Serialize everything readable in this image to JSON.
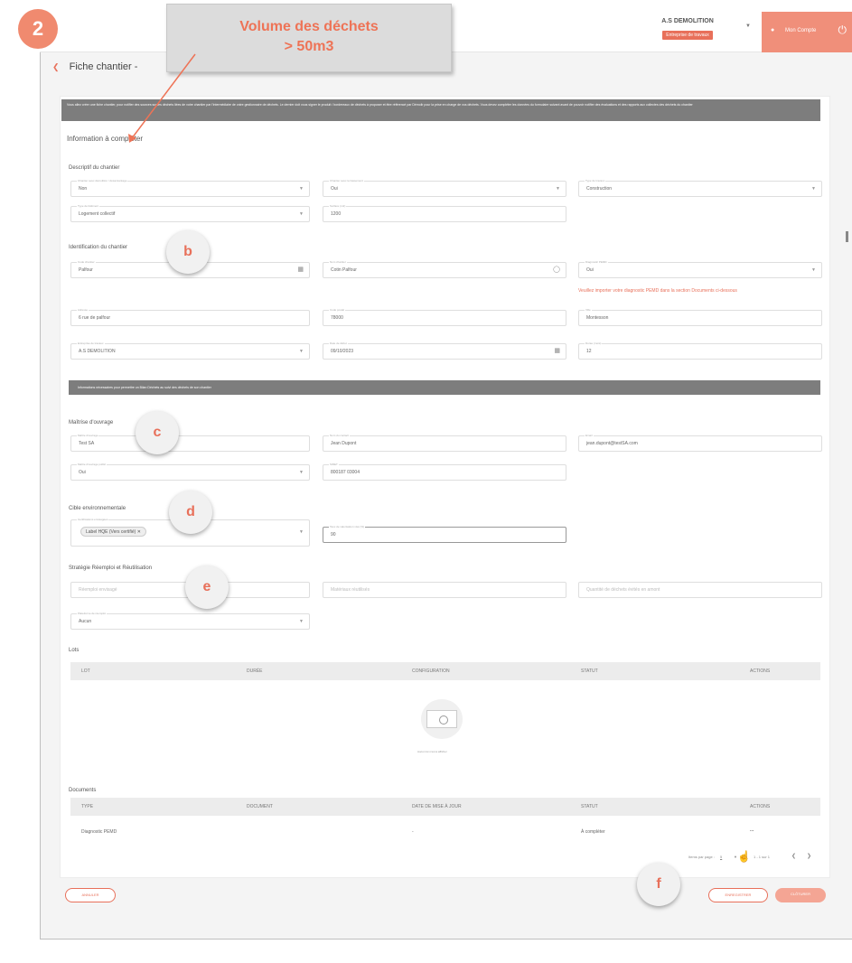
{
  "header": {
    "company_name": "A.S DEMOLITION",
    "company_badge": "Entreprise de travaux",
    "user_name": "Mon Compte"
  },
  "page": {
    "title": "Fiche chantier -",
    "info_banner": "Vous allez créer une fiche chantier, pour notifier des sources sur les déchets liées de votre chantier par l'intermédiaire de votre gestionnaire de déchets. Le dernier doit vous signer le produit / bordereaux de déchets à proposer et être référencé par Démolir pour la prise en charge de vos déchets. Vous devez compléter les données du formulaire suivant avant de pouvoir notifier des évaluations et des rapports aux collectes des déchets du chantier",
    "section_info": "Information à compléter"
  },
  "descriptif": {
    "title": "Descriptif du chantier",
    "fields": [
      {
        "label": "Chantier avec démolition / désamiantage",
        "value": "Non"
      },
      {
        "label": "Chantier avec terrassement",
        "value": "Oui"
      },
      {
        "label": "Type de travaux",
        "value": "Construction"
      },
      {
        "label": "Type de bâtiment",
        "value": "Logement collectif"
      },
      {
        "label": "Surface (m2)",
        "value": "1200"
      }
    ]
  },
  "identification": {
    "title": "Identification du chantier",
    "fields": [
      {
        "label": "Code chantier",
        "value": "Palfour"
      },
      {
        "label": "Nom chantier",
        "value": "Cotin Palfour"
      },
      {
        "label": "Diagnostic PEMD",
        "value": "Oui"
      },
      {
        "label": "Adresse",
        "value": "6 rue de palfour"
      },
      {
        "label": "Code postal",
        "value": "78000"
      },
      {
        "label": "Ville",
        "value": "Montesson"
      },
      {
        "label": "Entreprise de travaux",
        "value": "A.S DEMOLITION"
      },
      {
        "label": "Date de début",
        "value": "09/10/2023"
      },
      {
        "label": "Durée (mois)",
        "value": "12"
      }
    ],
    "warning": "Veuillez importer votre diagnostic PEMD dans la section Documents ci-dessous"
  },
  "sub_banner": "Informations nécessaires pour permettre un Bilan Déchets au suivi des déchets de son chantier",
  "maitrise": {
    "title": "Maîtrise d'ouvrage",
    "fields": [
      {
        "label": "Maître d'ouvrage",
        "value": "Test SA"
      },
      {
        "label": "Nom du contact",
        "value": "Jean Dupont"
      },
      {
        "label": "Email",
        "value": "jean.dupont@testSA.com"
      },
      {
        "label": "Maître d'ouvrage public",
        "value": "Oui"
      },
      {
        "label": "SIRET",
        "value": "800187 03004"
      }
    ]
  },
  "cible": {
    "title": "Cible environnementale",
    "chip": "Label HQE (Vers certifié)",
    "chip_label": "Certifications envisagées",
    "input_label": "Taux de valorisation visé (%)",
    "input_value": "90"
  },
  "strategie": {
    "title": "Stratégie Réemploi et Réutilisation",
    "placeholders": [
      "Réemploi envisagé",
      "Matériaux réutilisés",
      "Quantité de déchets évités en amont"
    ],
    "select_label": "Plateforme de réemploi",
    "select_value": "Aucun"
  },
  "lots": {
    "title": "Lots",
    "columns": [
      "LOT",
      "DURÉE",
      "CONFIGURATION",
      "STATUT",
      "ACTIONS"
    ],
    "empty_text": "Aucun lot n'est à afficher"
  },
  "documents": {
    "title": "Documents",
    "columns": [
      "TYPE",
      "DOCUMENT",
      "DATE DE MISE À JOUR",
      "STATUT",
      "ACTIONS"
    ],
    "rows": [
      {
        "type": "Diagnostic PEMD",
        "document": "",
        "date": "-",
        "statut": "À compléter",
        "actions": "..."
      }
    ],
    "pager": {
      "rows_label": "Items par page :",
      "rows_value": "5",
      "range": "1 - 1 sur 1"
    }
  },
  "buttons": {
    "cancel": "ANNULER",
    "save": "ENREGISTRER",
    "finish": "CLÔTURER"
  },
  "annotations": {
    "step": "2",
    "callout": "Volume des déchets",
    "callout2": "> 50m3",
    "b": "b",
    "c": "c",
    "d": "d",
    "e": "e",
    "f": "f"
  },
  "colors": {
    "accent": "#e8705a",
    "banner": "#7d7d7d"
  }
}
